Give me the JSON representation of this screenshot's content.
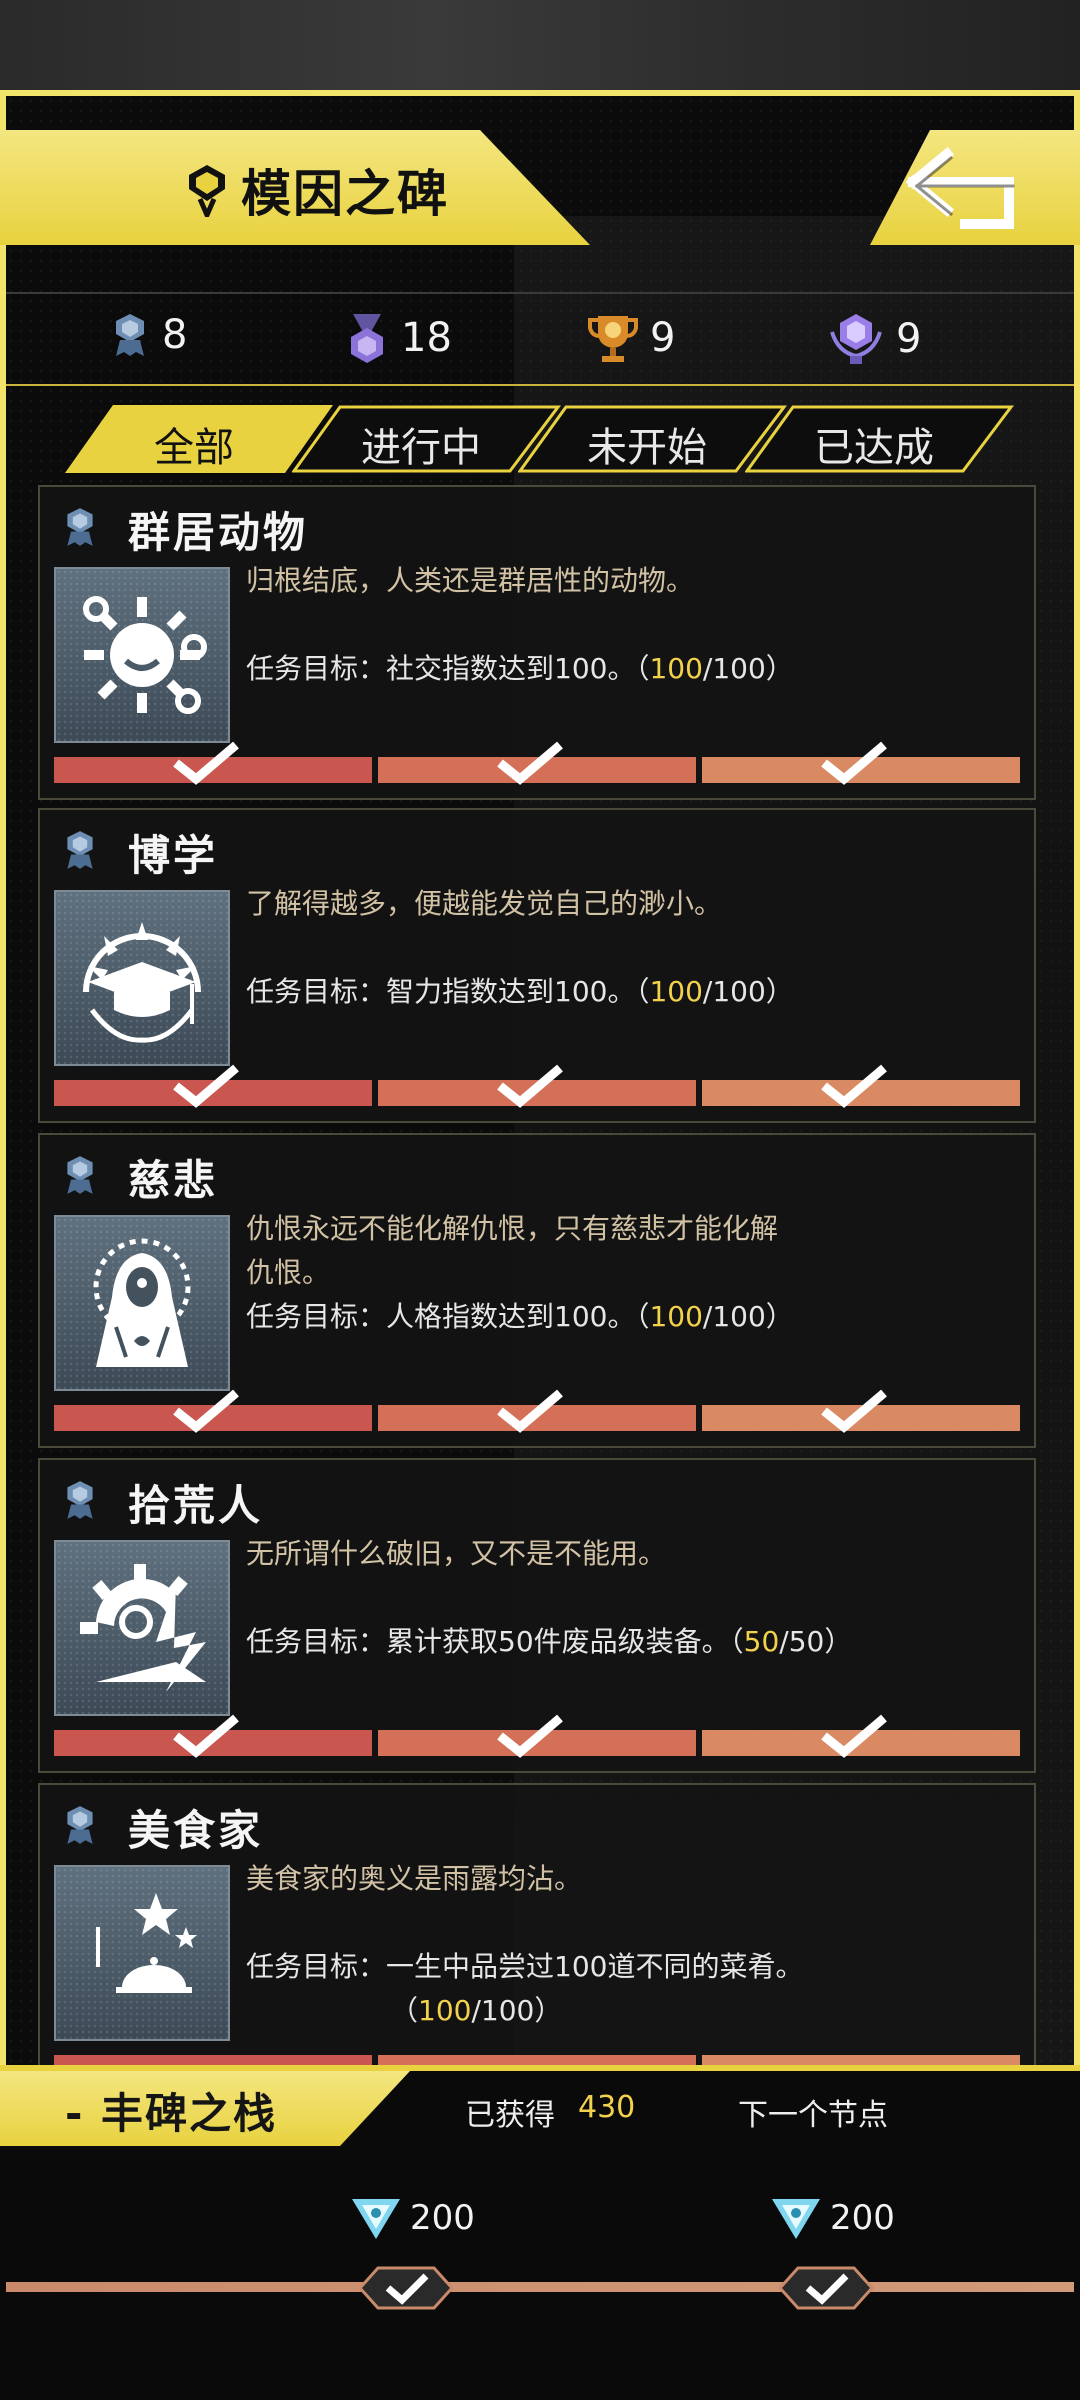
{
  "header": {
    "title": "模因之碑"
  },
  "stats": [
    {
      "icon": "blue-medal-icon",
      "value": "8"
    },
    {
      "icon": "purple-medal-icon",
      "value": "18"
    },
    {
      "icon": "gold-trophy-icon",
      "value": "9"
    },
    {
      "icon": "purple-gem-trophy-icon",
      "value": "9"
    }
  ],
  "tabs": [
    {
      "label": "全部",
      "active": true
    },
    {
      "label": "进行中",
      "active": false
    },
    {
      "label": "未开始",
      "active": false
    },
    {
      "label": "已达成",
      "active": false
    }
  ],
  "achievements": [
    {
      "name": "群居动物",
      "icon": "social-gear-icon",
      "description": "归根结底，人类还是群居性的动物。",
      "goal_prefix": "任务目标：社交指数达到100。（",
      "current": "100",
      "goal_suffix": "/100）",
      "goal_cont": "",
      "progress_segments": 3,
      "completed_segments": 3
    },
    {
      "name": "博学",
      "icon": "graduation-cap-icon",
      "description": "了解得越多，便越能发觉自己的渺小。",
      "goal_prefix": "任务目标：智力指数达到100。（",
      "current": "100",
      "goal_suffix": "/100）",
      "goal_cont": "",
      "progress_segments": 3,
      "completed_segments": 3
    },
    {
      "name": "慈悲",
      "icon": "hooded-figure-icon",
      "description": "仇恨永远不能化解仇恨，只有慈悲才能化解仇恨。",
      "goal_prefix": "任务目标：人格指数达到100。（",
      "current": "100",
      "goal_suffix": "/100）",
      "goal_cont": "",
      "progress_segments": 3,
      "completed_segments": 3
    },
    {
      "name": "拾荒人",
      "icon": "broken-gear-icon",
      "description": "无所谓什么破旧，又不是不能用。",
      "goal_prefix": "任务目标：累计获取50件废品级装备。（",
      "current": "50",
      "goal_suffix": "/50）",
      "goal_cont": "",
      "progress_segments": 3,
      "completed_segments": 3
    },
    {
      "name": "美食家",
      "icon": "moon-dish-icon",
      "description": "美食家的奥义是雨露均沾。",
      "goal_prefix": "任务目标：一生中品尝过100道不同的菜肴。",
      "current": "100",
      "goal_suffix": "/100）",
      "goal_cont": "（",
      "progress_segments": 3,
      "completed_segments": 3
    }
  ],
  "stele": {
    "title": "- 丰碑之栈",
    "earned_label": "已获得",
    "earned_value": "430",
    "next_label": "下一个节点",
    "rewards": [
      {
        "icon": "blue-crystal-icon",
        "value": "200",
        "claimed": true
      },
      {
        "icon": "blue-crystal-icon",
        "value": "200",
        "claimed": true
      }
    ]
  },
  "colors": {
    "accent_yellow": "#e8d23f",
    "progress_red": "#c9574f",
    "progress_orange": "#d98a62",
    "highlight_value": "#f2d24c"
  }
}
